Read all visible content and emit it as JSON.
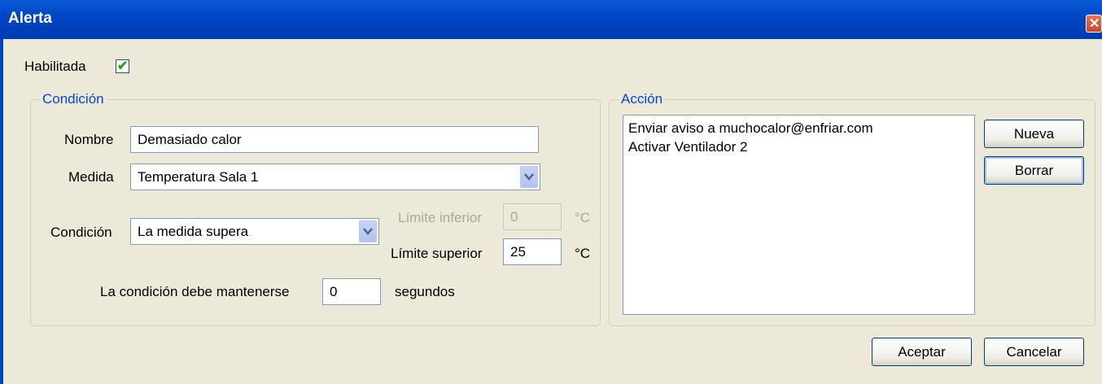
{
  "window": {
    "title": "Alerta",
    "close_glyph": "✕"
  },
  "enabled": {
    "label": "Habilitada",
    "checked": true
  },
  "condition_group": {
    "legend": "Condición",
    "name_label": "Nombre",
    "name_value": "Demasiado calor",
    "measure_label": "Medida",
    "measure_value": "Temperatura Sala 1",
    "condition_label": "Condición",
    "condition_value": "La medida supera",
    "lower_limit_label": "Límite inferior",
    "lower_limit_value": "0",
    "lower_limit_unit": "°C",
    "upper_limit_label": "Límite superior",
    "upper_limit_value": "25",
    "upper_limit_unit": "°C",
    "hold_label": "La condición debe mantenerse",
    "hold_value": "0",
    "hold_unit": "segundos"
  },
  "action_group": {
    "legend": "Acción",
    "items": [
      "Enviar aviso a muchocalor@enfriar.com",
      "Activar Ventilador 2"
    ],
    "new_button": "Nueva",
    "delete_button": "Borrar"
  },
  "footer": {
    "accept_button": "Aceptar",
    "cancel_button": "Cancelar"
  },
  "icons": {
    "checkbox_tick": "✔",
    "dropdown_arrow": "chevron-down-icon"
  }
}
